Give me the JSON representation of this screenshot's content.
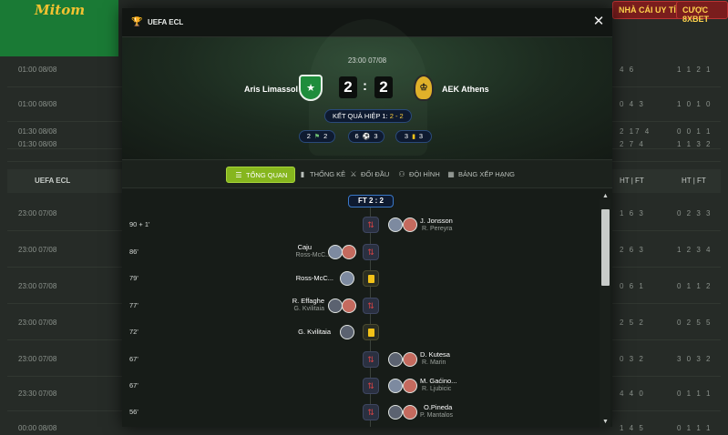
{
  "background": {
    "logo_text": "Mitom",
    "buttons": [
      "NHÀ CÁI UY TÍN",
      "CƯỢC 8XBET"
    ],
    "rows_top": [
      {
        "time": "01:00 08/08",
        "s1": "4 6",
        "s2": "1 1 2 1"
      },
      {
        "time": "01:00 08/08",
        "s1": "0 4 3",
        "s2": "1 0 1 0"
      },
      {
        "time": "01:30 08/08",
        "s1": "2 17 4",
        "s2": "0 0 1 1"
      },
      {
        "time": "01:30 08/08",
        "s1": "2 7 4",
        "s2": "1 1 3 2"
      }
    ],
    "section_header": {
      "name": "UEFA ECL",
      "ht_ft_1": "HT | FT",
      "ht_ft_2": "HT | FT"
    },
    "rows_bottom": [
      {
        "time": "23:00 07/08",
        "s1": "1 6 3",
        "s2": "0 2 3 3"
      },
      {
        "time": "23:00 07/08",
        "s1": "2 6 3",
        "s2": "1 2 3 4"
      },
      {
        "time": "23:00 07/08",
        "s1": "0 6 1",
        "s2": "0 1 1 2"
      },
      {
        "time": "23:00 07/08",
        "s1": "2 5 2",
        "s2": "0 2 5 5"
      },
      {
        "time": "23:00 07/08",
        "s1": "0 3 2",
        "s2": "3 0 3 2"
      },
      {
        "time": "23:30 07/08",
        "s1": "4 4 0",
        "s2": "0 1 1 1"
      },
      {
        "time": "00:00 08/08",
        "s1": "1 4 5",
        "s2": "0 1 1 1"
      }
    ]
  },
  "modal": {
    "title": "UEFA ECL",
    "close_glyph": "✕",
    "kickoff": "23:00 07/08",
    "home_team": "Aris Limassol",
    "away_team": "AEK Athens",
    "home_score": "2",
    "away_score": "2",
    "score_separator": ":",
    "ht_label": "KẾT QUẢ HIỆP 1:",
    "ht_value": "2 - 2",
    "stats": [
      {
        "home": "2",
        "away": "2",
        "icon": "corner-icon"
      },
      {
        "home": "6",
        "away": "3",
        "icon": "shot-icon"
      },
      {
        "home": "3",
        "away": "3",
        "icon": "yellow-card-icon"
      }
    ],
    "tabs": [
      {
        "label": "TỔNG QUAN",
        "icon": "list-icon",
        "active": true
      },
      {
        "label": "THỐNG KÊ",
        "icon": "bar-chart-icon"
      },
      {
        "label": "ĐỐI ĐẦU",
        "icon": "versus-icon"
      },
      {
        "label": "ĐỘI HÌNH",
        "icon": "lineup-icon"
      },
      {
        "label": "BẢNG XẾP HẠNG",
        "icon": "table-icon"
      }
    ],
    "ft_label": "FT 2 : 2",
    "events": [
      {
        "minute": "90 + 1'",
        "side": "away",
        "type": "sub",
        "p1": "J. Jonsson",
        "p2": "R. Pereyra"
      },
      {
        "minute": "86'",
        "side": "home",
        "type": "sub",
        "p1": "Caju",
        "p2": "Ross-McC..."
      },
      {
        "minute": "79'",
        "side": "home",
        "type": "card",
        "p1": "Ross-McC...",
        "p2": ""
      },
      {
        "minute": "77'",
        "side": "home",
        "type": "sub",
        "p1": "R. Effaghe",
        "p2": "G. Kvilitaia"
      },
      {
        "minute": "72'",
        "side": "home",
        "type": "card",
        "p1": "G. Kvilitaia",
        "p2": ""
      },
      {
        "minute": "67'",
        "side": "away",
        "type": "sub",
        "p1": "D. Kutesa",
        "p2": "R. Marin"
      },
      {
        "minute": "67'",
        "side": "away",
        "type": "sub",
        "p1": "M. Gaćino...",
        "p2": "R. Ljubicic"
      },
      {
        "minute": "56'",
        "side": "away",
        "type": "sub",
        "p1": "O.Pineda",
        "p2": "P. Mantalos"
      }
    ]
  }
}
